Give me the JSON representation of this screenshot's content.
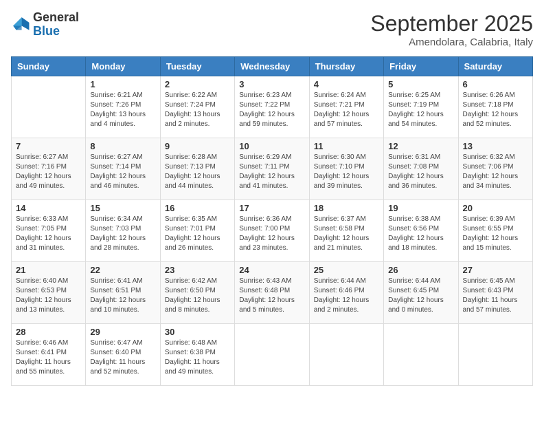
{
  "header": {
    "logo_general": "General",
    "logo_blue": "Blue",
    "month_title": "September 2025",
    "location": "Amendolara, Calabria, Italy"
  },
  "weekdays": [
    "Sunday",
    "Monday",
    "Tuesday",
    "Wednesday",
    "Thursday",
    "Friday",
    "Saturday"
  ],
  "weeks": [
    [
      {
        "day": "",
        "info": ""
      },
      {
        "day": "1",
        "info": "Sunrise: 6:21 AM\nSunset: 7:26 PM\nDaylight: 13 hours\nand 4 minutes."
      },
      {
        "day": "2",
        "info": "Sunrise: 6:22 AM\nSunset: 7:24 PM\nDaylight: 13 hours\nand 2 minutes."
      },
      {
        "day": "3",
        "info": "Sunrise: 6:23 AM\nSunset: 7:22 PM\nDaylight: 12 hours\nand 59 minutes."
      },
      {
        "day": "4",
        "info": "Sunrise: 6:24 AM\nSunset: 7:21 PM\nDaylight: 12 hours\nand 57 minutes."
      },
      {
        "day": "5",
        "info": "Sunrise: 6:25 AM\nSunset: 7:19 PM\nDaylight: 12 hours\nand 54 minutes."
      },
      {
        "day": "6",
        "info": "Sunrise: 6:26 AM\nSunset: 7:18 PM\nDaylight: 12 hours\nand 52 minutes."
      }
    ],
    [
      {
        "day": "7",
        "info": "Sunrise: 6:27 AM\nSunset: 7:16 PM\nDaylight: 12 hours\nand 49 minutes."
      },
      {
        "day": "8",
        "info": "Sunrise: 6:27 AM\nSunset: 7:14 PM\nDaylight: 12 hours\nand 46 minutes."
      },
      {
        "day": "9",
        "info": "Sunrise: 6:28 AM\nSunset: 7:13 PM\nDaylight: 12 hours\nand 44 minutes."
      },
      {
        "day": "10",
        "info": "Sunrise: 6:29 AM\nSunset: 7:11 PM\nDaylight: 12 hours\nand 41 minutes."
      },
      {
        "day": "11",
        "info": "Sunrise: 6:30 AM\nSunset: 7:10 PM\nDaylight: 12 hours\nand 39 minutes."
      },
      {
        "day": "12",
        "info": "Sunrise: 6:31 AM\nSunset: 7:08 PM\nDaylight: 12 hours\nand 36 minutes."
      },
      {
        "day": "13",
        "info": "Sunrise: 6:32 AM\nSunset: 7:06 PM\nDaylight: 12 hours\nand 34 minutes."
      }
    ],
    [
      {
        "day": "14",
        "info": "Sunrise: 6:33 AM\nSunset: 7:05 PM\nDaylight: 12 hours\nand 31 minutes."
      },
      {
        "day": "15",
        "info": "Sunrise: 6:34 AM\nSunset: 7:03 PM\nDaylight: 12 hours\nand 28 minutes."
      },
      {
        "day": "16",
        "info": "Sunrise: 6:35 AM\nSunset: 7:01 PM\nDaylight: 12 hours\nand 26 minutes."
      },
      {
        "day": "17",
        "info": "Sunrise: 6:36 AM\nSunset: 7:00 PM\nDaylight: 12 hours\nand 23 minutes."
      },
      {
        "day": "18",
        "info": "Sunrise: 6:37 AM\nSunset: 6:58 PM\nDaylight: 12 hours\nand 21 minutes."
      },
      {
        "day": "19",
        "info": "Sunrise: 6:38 AM\nSunset: 6:56 PM\nDaylight: 12 hours\nand 18 minutes."
      },
      {
        "day": "20",
        "info": "Sunrise: 6:39 AM\nSunset: 6:55 PM\nDaylight: 12 hours\nand 15 minutes."
      }
    ],
    [
      {
        "day": "21",
        "info": "Sunrise: 6:40 AM\nSunset: 6:53 PM\nDaylight: 12 hours\nand 13 minutes."
      },
      {
        "day": "22",
        "info": "Sunrise: 6:41 AM\nSunset: 6:51 PM\nDaylight: 12 hours\nand 10 minutes."
      },
      {
        "day": "23",
        "info": "Sunrise: 6:42 AM\nSunset: 6:50 PM\nDaylight: 12 hours\nand 8 minutes."
      },
      {
        "day": "24",
        "info": "Sunrise: 6:43 AM\nSunset: 6:48 PM\nDaylight: 12 hours\nand 5 minutes."
      },
      {
        "day": "25",
        "info": "Sunrise: 6:44 AM\nSunset: 6:46 PM\nDaylight: 12 hours\nand 2 minutes."
      },
      {
        "day": "26",
        "info": "Sunrise: 6:44 AM\nSunset: 6:45 PM\nDaylight: 12 hours\nand 0 minutes."
      },
      {
        "day": "27",
        "info": "Sunrise: 6:45 AM\nSunset: 6:43 PM\nDaylight: 11 hours\nand 57 minutes."
      }
    ],
    [
      {
        "day": "28",
        "info": "Sunrise: 6:46 AM\nSunset: 6:41 PM\nDaylight: 11 hours\nand 55 minutes."
      },
      {
        "day": "29",
        "info": "Sunrise: 6:47 AM\nSunset: 6:40 PM\nDaylight: 11 hours\nand 52 minutes."
      },
      {
        "day": "30",
        "info": "Sunrise: 6:48 AM\nSunset: 6:38 PM\nDaylight: 11 hours\nand 49 minutes."
      },
      {
        "day": "",
        "info": ""
      },
      {
        "day": "",
        "info": ""
      },
      {
        "day": "",
        "info": ""
      },
      {
        "day": "",
        "info": ""
      }
    ]
  ]
}
